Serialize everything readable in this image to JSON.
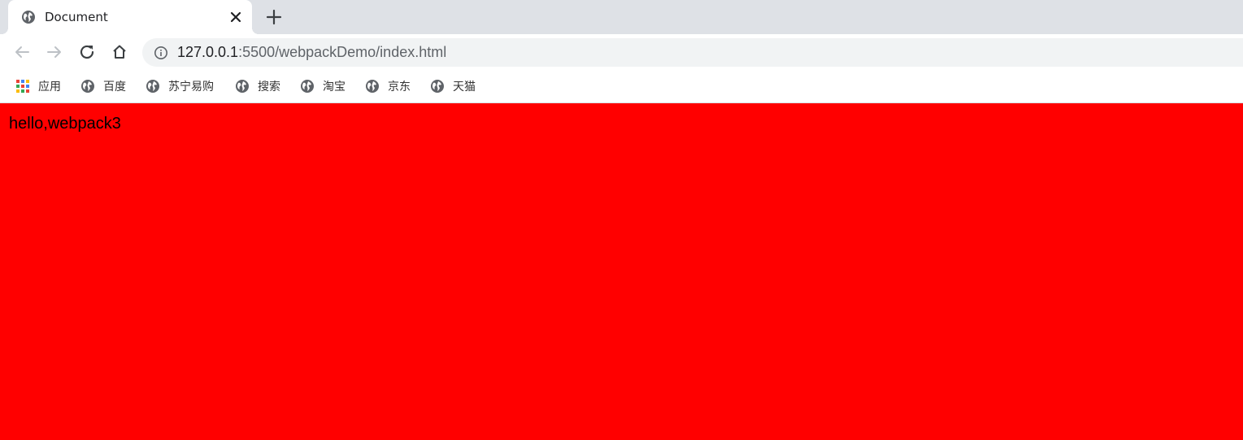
{
  "tab": {
    "title": "Document",
    "favicon": "globe-icon"
  },
  "omnibox": {
    "url_host": "127.0.0.1",
    "url_rest": ":5500/webpackDemo/index.html"
  },
  "bookmarks": [
    {
      "label": "应用",
      "icon": "apps-grid-icon"
    },
    {
      "label": "百度",
      "icon": "globe-icon"
    },
    {
      "label": "苏宁易购",
      "icon": "globe-icon"
    },
    {
      "label": "搜索",
      "icon": "globe-icon"
    },
    {
      "label": "淘宝",
      "icon": "globe-icon"
    },
    {
      "label": "京东",
      "icon": "globe-icon"
    },
    {
      "label": "天猫",
      "icon": "globe-icon"
    }
  ],
  "page": {
    "text": "hello,webpack3",
    "background": "#ff0000"
  },
  "colors": {
    "tabstrip": "#dee1e6",
    "omnibox": "#f1f3f4",
    "icon": "#5f6368"
  }
}
